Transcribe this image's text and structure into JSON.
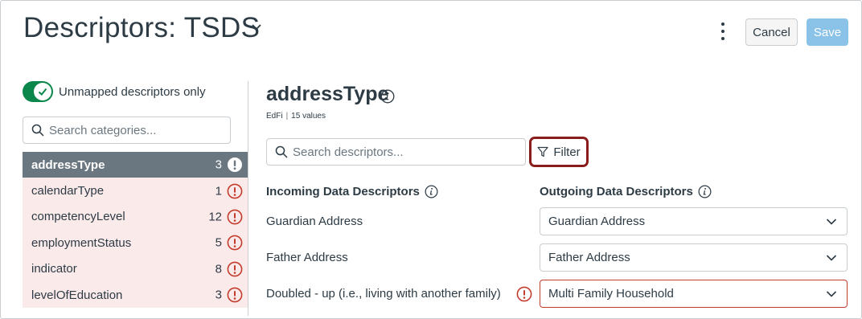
{
  "header": {
    "title": "Descriptors: TSDS",
    "cancel_label": "Cancel",
    "save_label": "Save"
  },
  "sidebar": {
    "toggle_label": "Unmapped descriptors only",
    "toggle_on": true,
    "search_placeholder": "Search categories...",
    "categories": [
      {
        "name": "addressType",
        "count": "3",
        "active": true
      },
      {
        "name": "calendarType",
        "count": "1",
        "active": false
      },
      {
        "name": "competencyLevel",
        "count": "12",
        "active": false
      },
      {
        "name": "employmentStatus",
        "count": "5",
        "active": false
      },
      {
        "name": "indicator",
        "count": "8",
        "active": false
      },
      {
        "name": "levelOfEducation",
        "count": "3",
        "active": false
      }
    ]
  },
  "main": {
    "category_title": "addressType",
    "source": "EdFi",
    "value_count": "15 values",
    "search_placeholder": "Search descriptors...",
    "filter_label": "Filter",
    "incoming_header": "Incoming Data Descriptors",
    "outgoing_header": "Outgoing Data Descriptors",
    "rows": [
      {
        "incoming": "Guardian Address",
        "outgoing": "Guardian Address",
        "error": false
      },
      {
        "incoming": "Father Address",
        "outgoing": "Father Address",
        "error": false
      },
      {
        "incoming": "Doubled - up (i.e., living with another family)",
        "outgoing": "Multi Family Household",
        "error": true
      }
    ]
  },
  "colors": {
    "toggle_on": "#0b874b",
    "error": "#c23c2d",
    "active_row": "#6b7780",
    "unmapped_row": "#fbeaea",
    "filter_highlight": "#8b1c1c",
    "save_disabled": "#8ac2e8"
  }
}
